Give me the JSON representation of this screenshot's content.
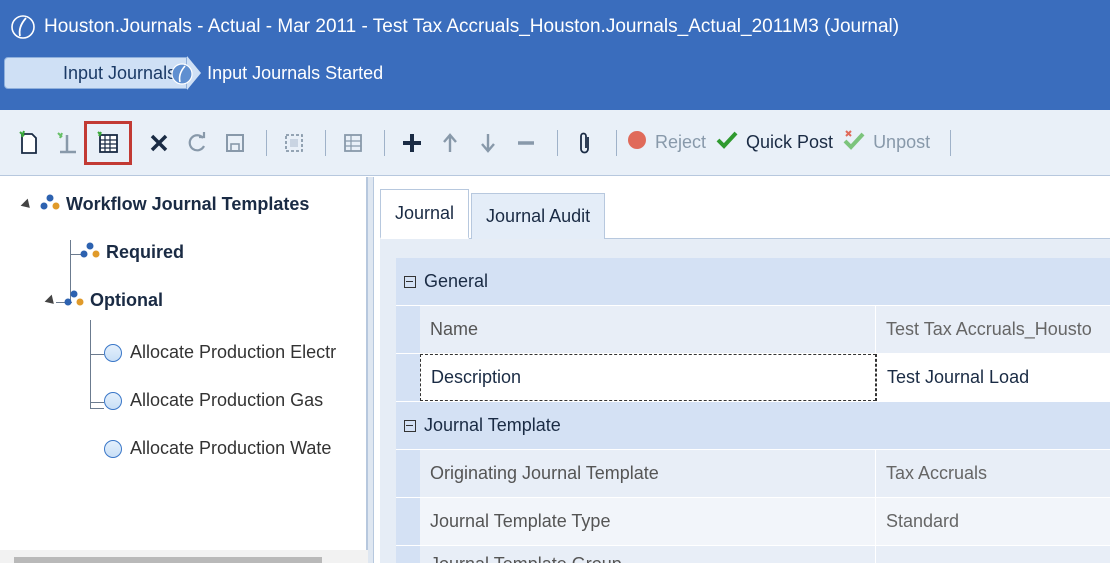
{
  "window": {
    "title": "Houston.Journals  -  Actual  -  Mar 2011 - Test Tax Accruals_Houston.Journals_Actual_2011M3 (Journal)"
  },
  "breadcrumb": {
    "step": "Input Journals",
    "status": "Input Journals Started"
  },
  "toolbar": {
    "reject_label": "Reject",
    "quick_post_label": "Quick Post",
    "unpost_label": "Unpost",
    "colors": {
      "selected_outline": "#c23a34",
      "reject": "#e04a3a",
      "quick_post": "#2f9a2f"
    }
  },
  "tree": {
    "root": "Workflow Journal Templates",
    "required": "Required",
    "optional": "Optional",
    "leaves": [
      "Allocate Production Electr",
      "Allocate Production Gas",
      "Allocate Production Wate"
    ]
  },
  "tabs": [
    {
      "label": "Journal",
      "active": true
    },
    {
      "label": "Journal Audit",
      "active": false
    }
  ],
  "grid": {
    "general_label": "General",
    "general_rows": [
      {
        "key": "Name",
        "value": "Test Tax Accruals_Housto"
      },
      {
        "key": "Description",
        "value": "Test Journal Load"
      }
    ],
    "template_label": "Journal Template",
    "template_rows": [
      {
        "key": "Originating Journal Template",
        "value": "Tax Accruals"
      },
      {
        "key": "Journal Template Type",
        "value": "Standard"
      },
      {
        "key": "Journal Template Group",
        "value": ""
      }
    ]
  },
  "colors": {
    "header_bg": "#3a6dbd",
    "toolbar_bg": "#e9f0f8",
    "group_bg": "#d4e1f4"
  }
}
